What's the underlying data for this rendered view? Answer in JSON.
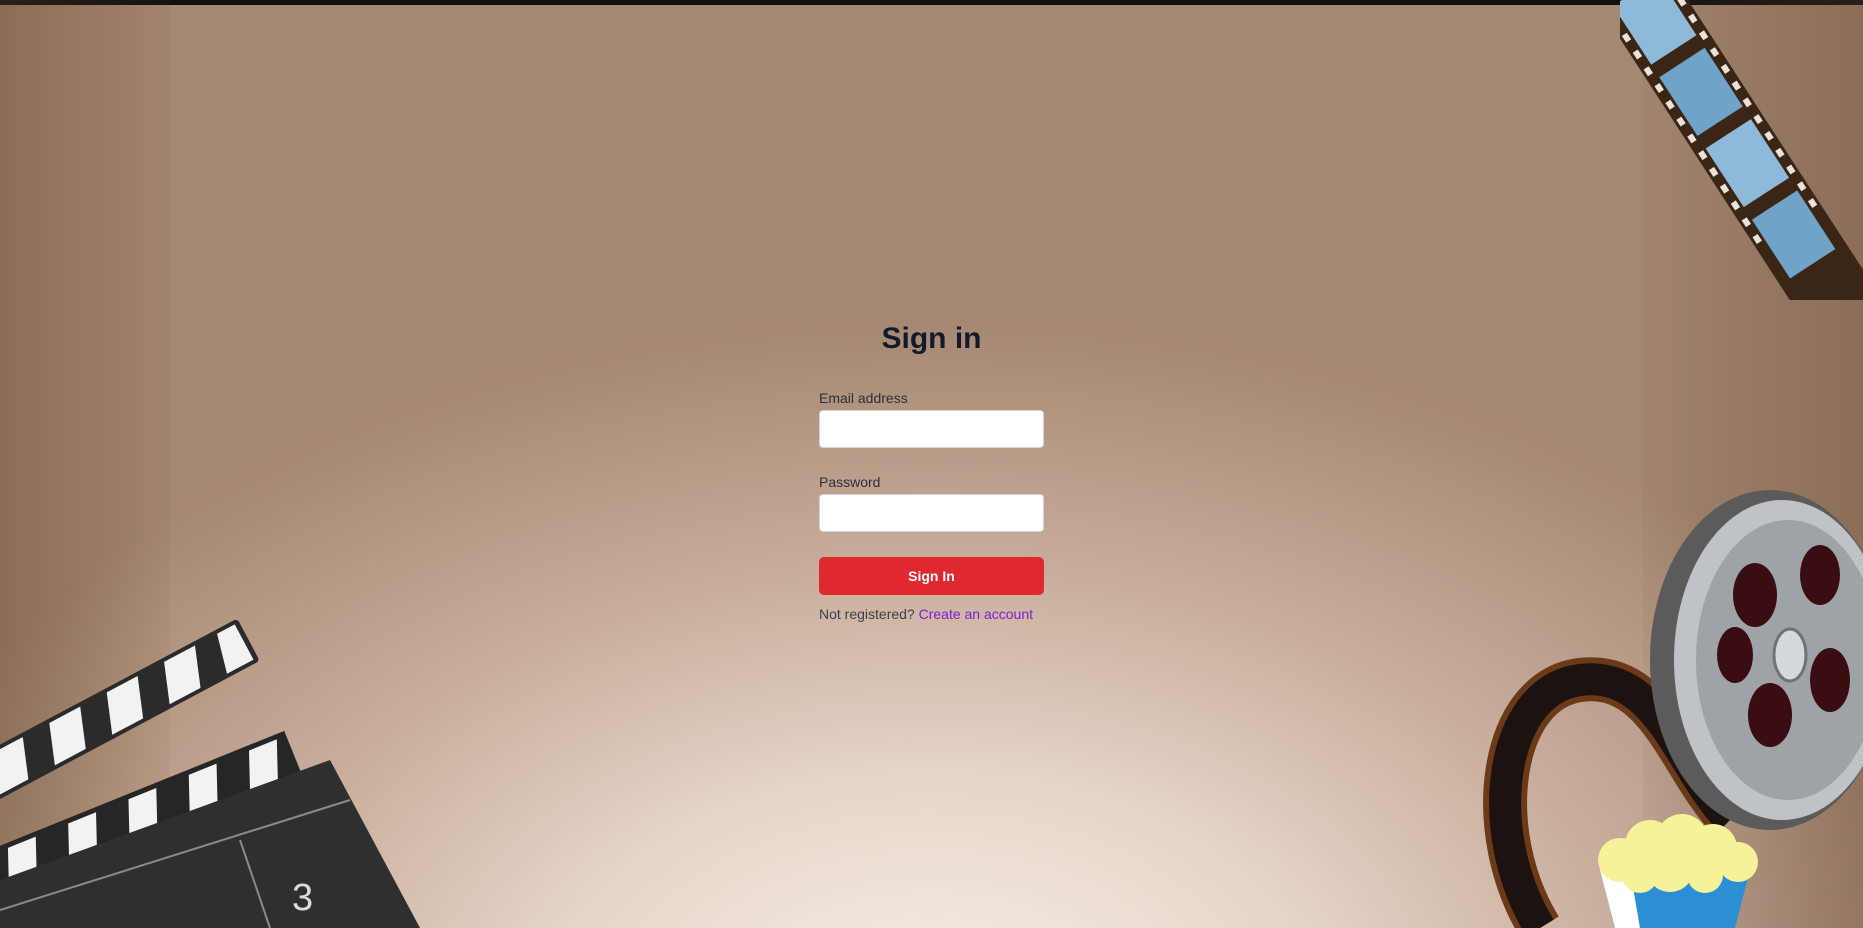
{
  "form": {
    "title": "Sign in",
    "email_label": "Email address",
    "email_value": "",
    "password_label": "Password",
    "password_value": "",
    "submit_label": "Sign In",
    "register_prompt": "Not registered?",
    "register_link": "Create an account"
  },
  "decor": {
    "clapperboard_number": "3"
  },
  "colors": {
    "accent": "#e0282f",
    "link": "#7a1fd6",
    "title": "#141a2b"
  }
}
